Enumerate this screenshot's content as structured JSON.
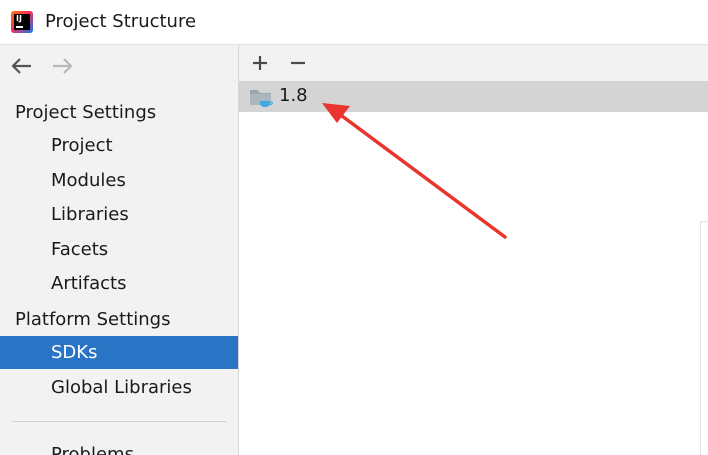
{
  "window": {
    "title": "Project Structure",
    "logo_text": "IJ"
  },
  "navigation": {
    "back_icon": "arrow-left-icon",
    "forward_icon": "arrow-right-icon"
  },
  "sidebar": {
    "project_settings_header": "Project Settings",
    "project_items": [
      {
        "label": "Project"
      },
      {
        "label": "Modules"
      },
      {
        "label": "Libraries"
      },
      {
        "label": "Facets"
      },
      {
        "label": "Artifacts"
      }
    ],
    "platform_settings_header": "Platform Settings",
    "platform_items": [
      {
        "label": "SDKs",
        "selected": true
      },
      {
        "label": "Global Libraries",
        "selected": false
      }
    ],
    "problems_label": "Problems"
  },
  "toolbar": {
    "add_icon": "plus-icon",
    "remove_icon": "minus-icon"
  },
  "sdk_list": [
    {
      "name": "1.8",
      "icon": "jdk-folder-icon",
      "selected": true
    }
  ],
  "colors": {
    "selection_blue": "#2a74c6",
    "sidebar_bg": "#f2f2f2",
    "row_selected_bg": "#d4d4d4",
    "annotation_arrow": "#e8352e"
  }
}
